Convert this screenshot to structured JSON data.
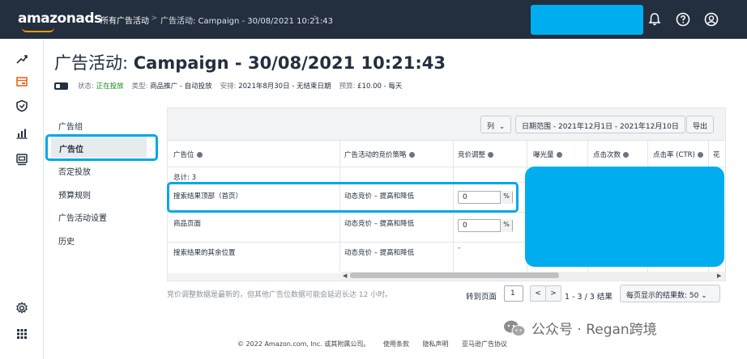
{
  "topbar": {
    "logo_main": "amazon",
    "logo_ads": "ads",
    "breadcrumb_all": "所有广告活动",
    "breadcrumb_sep": ">",
    "breadcrumb_campaign": "广告活动: Campaign - 30/08/2021 10:21:43",
    "icons": [
      "bell-icon",
      "help-icon",
      "account-icon"
    ]
  },
  "rail": {
    "icons": [
      "trend-icon",
      "campaign-icon",
      "shield-icon",
      "bar-chart-icon",
      "media-icon",
      "settings-icon",
      "apps-grid-icon"
    ]
  },
  "header": {
    "title_prefix": "广告活动:",
    "title_name": "Campaign - 30/08/2021 10:21:43",
    "status_label": "状态:",
    "status_value": "正在投放",
    "type_label": "类型:",
    "type_value": "商品推广 - 自动投放",
    "schedule_label": "安排:",
    "schedule_value": "2021年8月30日 - 无结束日期",
    "budget_label": "预算:",
    "budget_value": "£10.00 - 每天"
  },
  "sidenav": {
    "items": [
      {
        "label": "广告组"
      },
      {
        "label": "广告位"
      },
      {
        "label": "否定投放"
      },
      {
        "label": "预算规则"
      },
      {
        "label": "广告活动设置"
      },
      {
        "label": "历史"
      }
    ],
    "active_index": 1
  },
  "toolbar": {
    "columns_label": "列",
    "date_range_label": "日期范围 - 2021年12月1日 - 2021年12月10日",
    "export_label": "导出"
  },
  "table": {
    "headers": [
      "广告位",
      "广告活动的竞价策略",
      "竞价调整",
      "曝光量",
      "点击次数",
      "点击率 (CTR)",
      "花"
    ],
    "total_label": "总计: 3",
    "rows": [
      {
        "placement": "搜索结果顶部（首页）",
        "strategy": "动态竞价 – 提高和降低",
        "adjust": "0",
        "unit": "%"
      },
      {
        "placement": "商品页面",
        "strategy": "动态竞价 – 提高和降低",
        "adjust": "0",
        "unit": "%"
      },
      {
        "placement": "搜索结果的其余位置",
        "strategy": "动态竞价 – 提高和降低",
        "adjust": "-",
        "unit": ""
      }
    ]
  },
  "footer": {
    "note": "竞价调整数据是最新的，但其他广告位数据可能会延迟长达 12 小时。",
    "goto_label": "转到页面",
    "page_value": "1",
    "prev": "<",
    "next": ">",
    "results_label": "1 - 3 / 3 结果",
    "per_page_label": "每页显示的结果数:  50"
  },
  "copyright": {
    "text": "© 2022 Amazon.com, Inc. 或其附属公司。",
    "terms": "使用条款",
    "privacy": "隐私声明",
    "agreement": "亚马逊广告协议"
  },
  "watermark": {
    "text": "公众号 · Regan跨境"
  },
  "colors": {
    "topbar": "#232f3e",
    "accent_orange": "#ff9900",
    "highlight_blue": "#00a8e8",
    "status_green": "#1a8e1a"
  }
}
